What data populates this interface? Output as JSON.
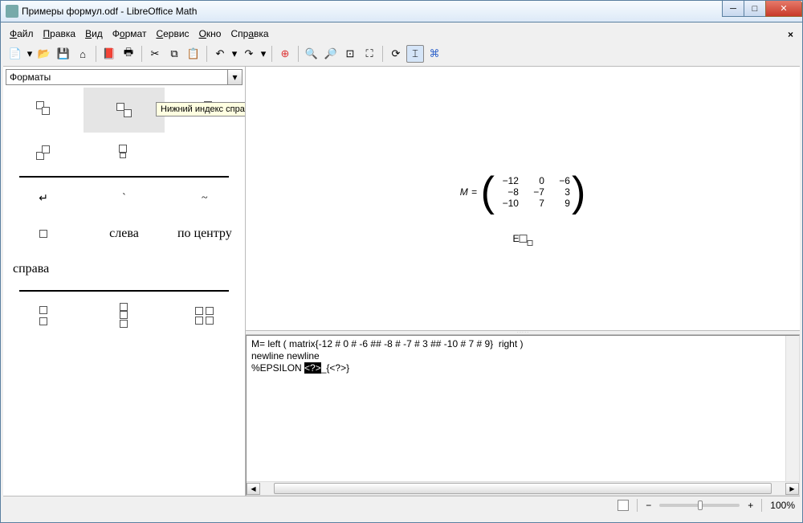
{
  "title": "Примеры формул.odf - LibreOffice Math",
  "menu": {
    "file": "Файл",
    "edit": "Правка",
    "view": "Вид",
    "format": "Формат",
    "tools": "Сервис",
    "window": "Окно",
    "help": "Справка"
  },
  "combo": {
    "value": "Форматы"
  },
  "tooltip": "Нижний индекс справа",
  "palette": {
    "row3": {
      "c1": "слева",
      "c2": "по центру"
    },
    "row4": {
      "c0": "справа"
    }
  },
  "formula": {
    "varM": "M",
    "eq": "=",
    "matrix": [
      [
        "−12",
        "0",
        "−6"
      ],
      [
        "−8",
        "−7",
        "3"
      ],
      [
        "−10",
        "7",
        "9"
      ]
    ],
    "eps": "E"
  },
  "code": {
    "l1": "M= left ( matrix{-12 # 0 # -6 ## -8 # -7 # 3 ## -10 # 7 # 9}  right )",
    "l2": "newline newline",
    "l3a": "%EPSILON ",
    "l3sel": "<?>",
    "l3b": "_{<?>}"
  },
  "status": {
    "zoom": "100%",
    "minus": "−",
    "plus": "+"
  }
}
